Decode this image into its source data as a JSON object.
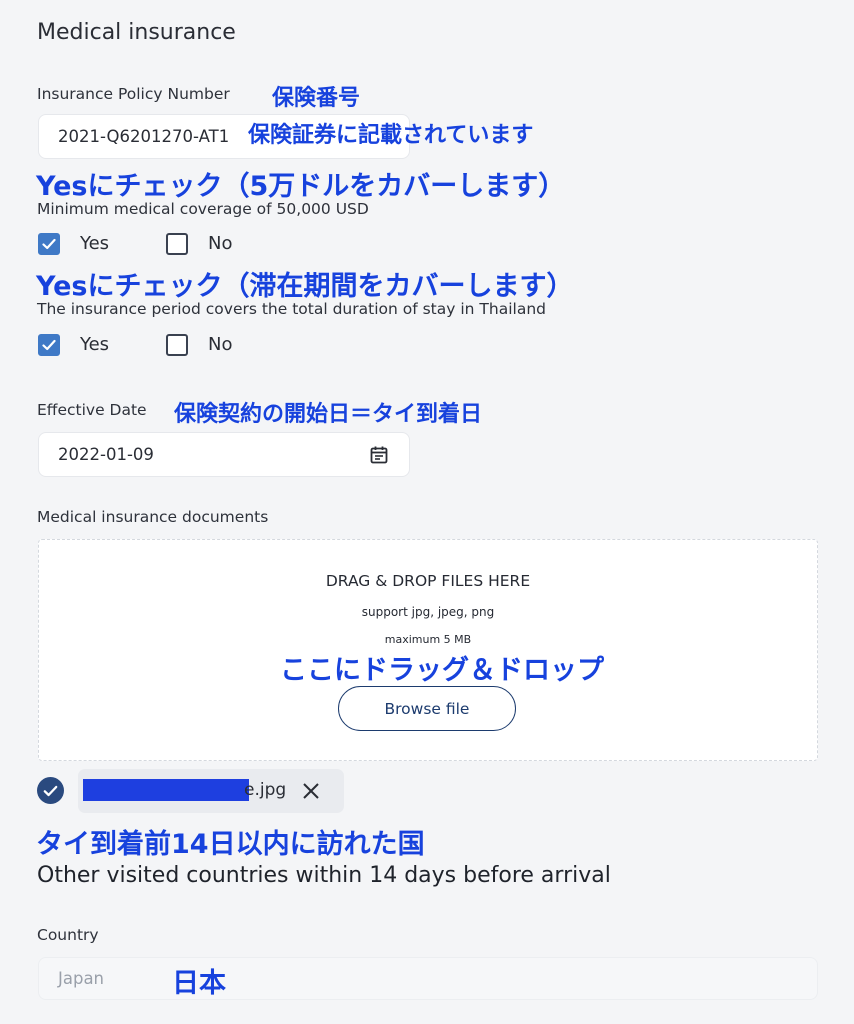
{
  "section_title": "Medical insurance",
  "policy": {
    "label": "Insurance Policy Number",
    "value": "2021-Q6201270-AT1",
    "annot_title": "保険番号",
    "annot_note": "保険証券に記載されています"
  },
  "coverage": {
    "annot": "Yesにチェック（5万ドルをカバーします）",
    "question": "Minimum medical coverage of 50,000 USD",
    "yes_label": "Yes",
    "no_label": "No",
    "yes_checked": true,
    "no_checked": false
  },
  "period": {
    "annot": "Yesにチェック（滞在期間をカバーします）",
    "question": "The insurance period covers the total duration of stay in Thailand",
    "yes_label": "Yes",
    "no_label": "No",
    "yes_checked": true,
    "no_checked": false
  },
  "effective_date": {
    "label": "Effective Date",
    "annot": "保険契約の開始日＝タイ到着日",
    "value": "2022-01-09",
    "icon": "calendar-icon"
  },
  "documents": {
    "label": "Medical insurance documents",
    "drop_title": "DRAG & DROP FILES HERE",
    "support": "support jpg, jpeg, png",
    "max_size": "maximum 5 MB",
    "annot": "ここにドラッグ＆ドロップ",
    "browse_label": "Browse file",
    "uploaded_file_suffix": "e.jpg",
    "check_icon": "check-circle-icon",
    "remove_icon": "close-icon"
  },
  "visited": {
    "annot": "タイ到着前14日以内に訪れた国",
    "heading": "Other visited countries within 14 days before arrival"
  },
  "country": {
    "label": "Country",
    "placeholder": "Japan",
    "annot": "日本"
  },
  "colors": {
    "annotation": "#1742dd",
    "checkbox_checked": "#3f79c6",
    "button_border": "#1c3b6e",
    "redaction": "#1e3fe0"
  }
}
